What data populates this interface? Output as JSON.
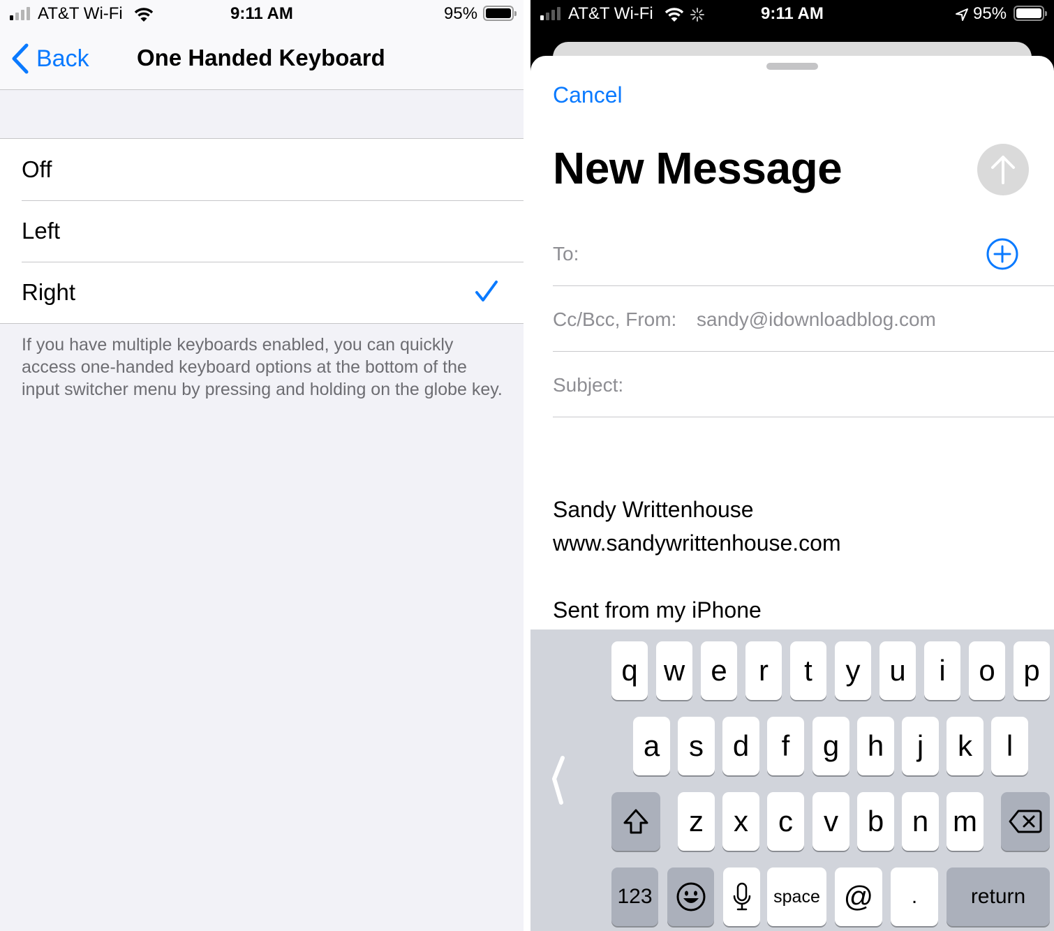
{
  "left_screen": {
    "status_bar": {
      "carrier": "AT&T Wi-Fi",
      "time": "9:11 AM",
      "battery_percent": "95%"
    },
    "nav": {
      "back_label": "Back",
      "title": "One Handed Keyboard"
    },
    "options": [
      {
        "label": "Off",
        "selected": false
      },
      {
        "label": "Left",
        "selected": false
      },
      {
        "label": "Right",
        "selected": true
      }
    ],
    "footnote": "If you have multiple keyboards enabled, you can quickly access one-handed keyboard options at the bottom of the input switcher menu by pressing and holding on the globe key."
  },
  "right_screen": {
    "status_bar": {
      "carrier": "AT&T Wi-Fi",
      "time": "9:11 AM",
      "battery_percent": "95%"
    },
    "compose": {
      "cancel_label": "Cancel",
      "title": "New Message",
      "to_label": "To:",
      "to_value": "",
      "cc_from_label": "Cc/Bcc, From:",
      "from_value": "sandy@idownloadblog.com",
      "subject_label": "Subject:",
      "subject_value": "",
      "body": {
        "signature_name": "Sandy Writtenhouse",
        "signature_url": "www.sandywrittenhouse.com",
        "sent_from": "Sent from my iPhone"
      }
    },
    "keyboard": {
      "mode": "one-handed-right",
      "row1": [
        "q",
        "w",
        "e",
        "r",
        "t",
        "y",
        "u",
        "i",
        "o",
        "p"
      ],
      "row2": [
        "a",
        "s",
        "d",
        "f",
        "g",
        "h",
        "j",
        "k",
        "l"
      ],
      "row3": [
        "z",
        "x",
        "c",
        "v",
        "b",
        "n",
        "m"
      ],
      "bottom": {
        "numbers": "123",
        "space": "space",
        "at": "@",
        "period": ".",
        "return": "return"
      }
    }
  },
  "colors": {
    "accent": "#0a7aff",
    "secondary_text": "#8e8e93",
    "settings_bg": "#f2f2f7",
    "keyboard_bg": "#d1d4db"
  }
}
